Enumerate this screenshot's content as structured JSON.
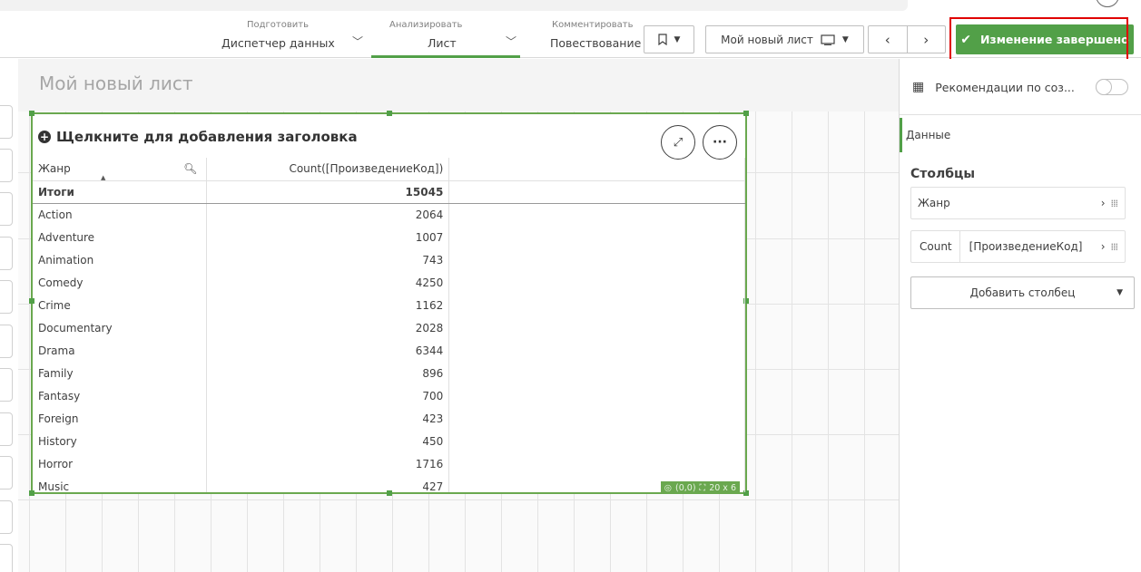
{
  "colors": {
    "accent": "#52a048",
    "selection_border": "#6aa84f",
    "highlight_box": "#e00000"
  },
  "toolbar": {
    "modes": [
      {
        "small": "Подготовить",
        "big": "Диспетчер данных",
        "icon": "chevron-down-icon"
      },
      {
        "small": "Анализировать",
        "big": "Лист",
        "icon": "chevron-down-icon",
        "active": true
      },
      {
        "small": "Комментировать",
        "big": "Повествование"
      }
    ],
    "bookmark_icon": "bookmark-icon",
    "sheet_name": "Мой новый лист",
    "done_label": "Изменение завершено"
  },
  "sheet": {
    "title": "Мой новый лист"
  },
  "table_object": {
    "title": "Щелкните для добавления заголовка",
    "columns": [
      "Жанр",
      "Count([ПроизведениеКод])"
    ],
    "total_label": "Итоги",
    "total_value": "15045",
    "rows": [
      {
        "genre": "Action",
        "count": "2064"
      },
      {
        "genre": "Adventure",
        "count": "1007"
      },
      {
        "genre": "Animation",
        "count": "743"
      },
      {
        "genre": "Comedy",
        "count": "4250"
      },
      {
        "genre": "Crime",
        "count": "1162"
      },
      {
        "genre": "Documentary",
        "count": "2028"
      },
      {
        "genre": "Drama",
        "count": "6344"
      },
      {
        "genre": "Family",
        "count": "896"
      },
      {
        "genre": "Fantasy",
        "count": "700"
      },
      {
        "genre": "Foreign",
        "count": "423"
      },
      {
        "genre": "History",
        "count": "450"
      },
      {
        "genre": "Horror",
        "count": "1716"
      },
      {
        "genre": "Music",
        "count": "427"
      }
    ],
    "position_badge": "(0,0)",
    "size_badge": "20 x 6"
  },
  "panel": {
    "recommendations_label": "Рекомендации по соз...",
    "tab_data": "Данные",
    "columns_heading": "Столбцы",
    "column_items": [
      {
        "label": "Жанр"
      },
      {
        "agg": "Count",
        "label": "[ПроизведениеКод]"
      }
    ],
    "add_column_label": "Добавить столбец"
  }
}
